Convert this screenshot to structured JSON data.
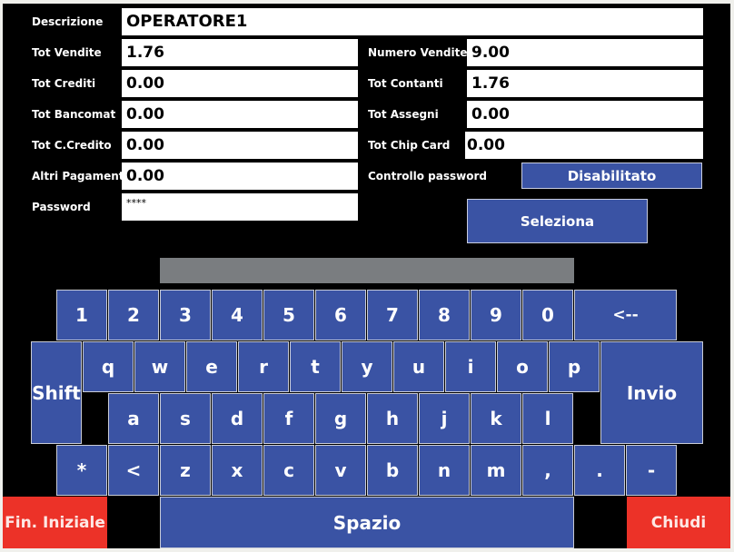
{
  "form": {
    "descrizione": {
      "label": "Descrizione",
      "value": "OPERATORE1"
    },
    "tot_vendite": {
      "label": "Tot Vendite",
      "value": "1.76"
    },
    "tot_crediti": {
      "label": "Tot Crediti",
      "value": "0.00"
    },
    "tot_bancomat": {
      "label": "Tot Bancomat",
      "value": "0.00"
    },
    "tot_ccredito": {
      "label": "Tot C.Credito",
      "value": "0.00"
    },
    "altri_pagamenti": {
      "label": "Altri Pagamenti",
      "value": "0.00"
    },
    "password": {
      "label": "Password",
      "value": "****"
    },
    "numero_vendite": {
      "label": "Numero Vendite",
      "value": "9.00"
    },
    "tot_contanti": {
      "label": "Tot Contanti",
      "value": "1.76"
    },
    "tot_assegni": {
      "label": "Tot Assegni",
      "value": "0.00"
    },
    "tot_chip_card": {
      "label": "Tot Chip Card",
      "value": "0.00"
    },
    "controllo_password": {
      "label": "Controllo password",
      "value": "Disabilitato"
    },
    "seleziona_label": "Seleziona"
  },
  "keyboard": {
    "display_value": "",
    "row1": [
      "1",
      "2",
      "3",
      "4",
      "5",
      "6",
      "7",
      "8",
      "9",
      "0"
    ],
    "backspace": "<--",
    "row2": [
      "q",
      "w",
      "e",
      "r",
      "t",
      "y",
      "u",
      "i",
      "o",
      "p"
    ],
    "shift": "Shift",
    "enter": "Invio",
    "row3": [
      "a",
      "s",
      "d",
      "f",
      "g",
      "h",
      "j",
      "k",
      "l"
    ],
    "row4": [
      "*",
      "<",
      "z",
      "x",
      "c",
      "v",
      "b",
      "n",
      "m",
      ",",
      ".",
      "-"
    ],
    "space": "Spazio"
  },
  "footer": {
    "fin_iniziale": "Fin. Iniziale",
    "chiudi": "Chiudi"
  },
  "colors": {
    "key_blue": "#3a53a4",
    "action_red": "#ec3228",
    "display_gray": "#7a7d80"
  }
}
